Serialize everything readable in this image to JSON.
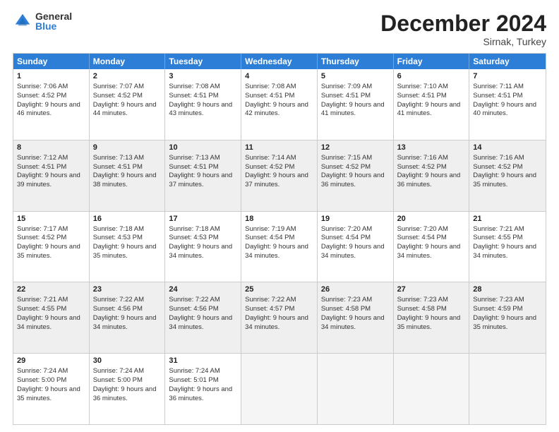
{
  "logo": {
    "general": "General",
    "blue": "Blue"
  },
  "title": "December 2024",
  "subtitle": "Sirnak, Turkey",
  "headers": [
    "Sunday",
    "Monday",
    "Tuesday",
    "Wednesday",
    "Thursday",
    "Friday",
    "Saturday"
  ],
  "rows": [
    [
      {
        "day": "1",
        "sunrise": "Sunrise: 7:06 AM",
        "sunset": "Sunset: 4:52 PM",
        "daylight": "Daylight: 9 hours and 46 minutes."
      },
      {
        "day": "2",
        "sunrise": "Sunrise: 7:07 AM",
        "sunset": "Sunset: 4:52 PM",
        "daylight": "Daylight: 9 hours and 44 minutes."
      },
      {
        "day": "3",
        "sunrise": "Sunrise: 7:08 AM",
        "sunset": "Sunset: 4:51 PM",
        "daylight": "Daylight: 9 hours and 43 minutes."
      },
      {
        "day": "4",
        "sunrise": "Sunrise: 7:08 AM",
        "sunset": "Sunset: 4:51 PM",
        "daylight": "Daylight: 9 hours and 42 minutes."
      },
      {
        "day": "5",
        "sunrise": "Sunrise: 7:09 AM",
        "sunset": "Sunset: 4:51 PM",
        "daylight": "Daylight: 9 hours and 41 minutes."
      },
      {
        "day": "6",
        "sunrise": "Sunrise: 7:10 AM",
        "sunset": "Sunset: 4:51 PM",
        "daylight": "Daylight: 9 hours and 41 minutes."
      },
      {
        "day": "7",
        "sunrise": "Sunrise: 7:11 AM",
        "sunset": "Sunset: 4:51 PM",
        "daylight": "Daylight: 9 hours and 40 minutes."
      }
    ],
    [
      {
        "day": "8",
        "sunrise": "Sunrise: 7:12 AM",
        "sunset": "Sunset: 4:51 PM",
        "daylight": "Daylight: 9 hours and 39 minutes."
      },
      {
        "day": "9",
        "sunrise": "Sunrise: 7:13 AM",
        "sunset": "Sunset: 4:51 PM",
        "daylight": "Daylight: 9 hours and 38 minutes."
      },
      {
        "day": "10",
        "sunrise": "Sunrise: 7:13 AM",
        "sunset": "Sunset: 4:51 PM",
        "daylight": "Daylight: 9 hours and 37 minutes."
      },
      {
        "day": "11",
        "sunrise": "Sunrise: 7:14 AM",
        "sunset": "Sunset: 4:52 PM",
        "daylight": "Daylight: 9 hours and 37 minutes."
      },
      {
        "day": "12",
        "sunrise": "Sunrise: 7:15 AM",
        "sunset": "Sunset: 4:52 PM",
        "daylight": "Daylight: 9 hours and 36 minutes."
      },
      {
        "day": "13",
        "sunrise": "Sunrise: 7:16 AM",
        "sunset": "Sunset: 4:52 PM",
        "daylight": "Daylight: 9 hours and 36 minutes."
      },
      {
        "day": "14",
        "sunrise": "Sunrise: 7:16 AM",
        "sunset": "Sunset: 4:52 PM",
        "daylight": "Daylight: 9 hours and 35 minutes."
      }
    ],
    [
      {
        "day": "15",
        "sunrise": "Sunrise: 7:17 AM",
        "sunset": "Sunset: 4:52 PM",
        "daylight": "Daylight: 9 hours and 35 minutes."
      },
      {
        "day": "16",
        "sunrise": "Sunrise: 7:18 AM",
        "sunset": "Sunset: 4:53 PM",
        "daylight": "Daylight: 9 hours and 35 minutes."
      },
      {
        "day": "17",
        "sunrise": "Sunrise: 7:18 AM",
        "sunset": "Sunset: 4:53 PM",
        "daylight": "Daylight: 9 hours and 34 minutes."
      },
      {
        "day": "18",
        "sunrise": "Sunrise: 7:19 AM",
        "sunset": "Sunset: 4:54 PM",
        "daylight": "Daylight: 9 hours and 34 minutes."
      },
      {
        "day": "19",
        "sunrise": "Sunrise: 7:20 AM",
        "sunset": "Sunset: 4:54 PM",
        "daylight": "Daylight: 9 hours and 34 minutes."
      },
      {
        "day": "20",
        "sunrise": "Sunrise: 7:20 AM",
        "sunset": "Sunset: 4:54 PM",
        "daylight": "Daylight: 9 hours and 34 minutes."
      },
      {
        "day": "21",
        "sunrise": "Sunrise: 7:21 AM",
        "sunset": "Sunset: 4:55 PM",
        "daylight": "Daylight: 9 hours and 34 minutes."
      }
    ],
    [
      {
        "day": "22",
        "sunrise": "Sunrise: 7:21 AM",
        "sunset": "Sunset: 4:55 PM",
        "daylight": "Daylight: 9 hours and 34 minutes."
      },
      {
        "day": "23",
        "sunrise": "Sunrise: 7:22 AM",
        "sunset": "Sunset: 4:56 PM",
        "daylight": "Daylight: 9 hours and 34 minutes."
      },
      {
        "day": "24",
        "sunrise": "Sunrise: 7:22 AM",
        "sunset": "Sunset: 4:56 PM",
        "daylight": "Daylight: 9 hours and 34 minutes."
      },
      {
        "day": "25",
        "sunrise": "Sunrise: 7:22 AM",
        "sunset": "Sunset: 4:57 PM",
        "daylight": "Daylight: 9 hours and 34 minutes."
      },
      {
        "day": "26",
        "sunrise": "Sunrise: 7:23 AM",
        "sunset": "Sunset: 4:58 PM",
        "daylight": "Daylight: 9 hours and 34 minutes."
      },
      {
        "day": "27",
        "sunrise": "Sunrise: 7:23 AM",
        "sunset": "Sunset: 4:58 PM",
        "daylight": "Daylight: 9 hours and 35 minutes."
      },
      {
        "day": "28",
        "sunrise": "Sunrise: 7:23 AM",
        "sunset": "Sunset: 4:59 PM",
        "daylight": "Daylight: 9 hours and 35 minutes."
      }
    ],
    [
      {
        "day": "29",
        "sunrise": "Sunrise: 7:24 AM",
        "sunset": "Sunset: 5:00 PM",
        "daylight": "Daylight: 9 hours and 35 minutes."
      },
      {
        "day": "30",
        "sunrise": "Sunrise: 7:24 AM",
        "sunset": "Sunset: 5:00 PM",
        "daylight": "Daylight: 9 hours and 36 minutes."
      },
      {
        "day": "31",
        "sunrise": "Sunrise: 7:24 AM",
        "sunset": "Sunset: 5:01 PM",
        "daylight": "Daylight: 9 hours and 36 minutes."
      },
      null,
      null,
      null,
      null
    ]
  ]
}
